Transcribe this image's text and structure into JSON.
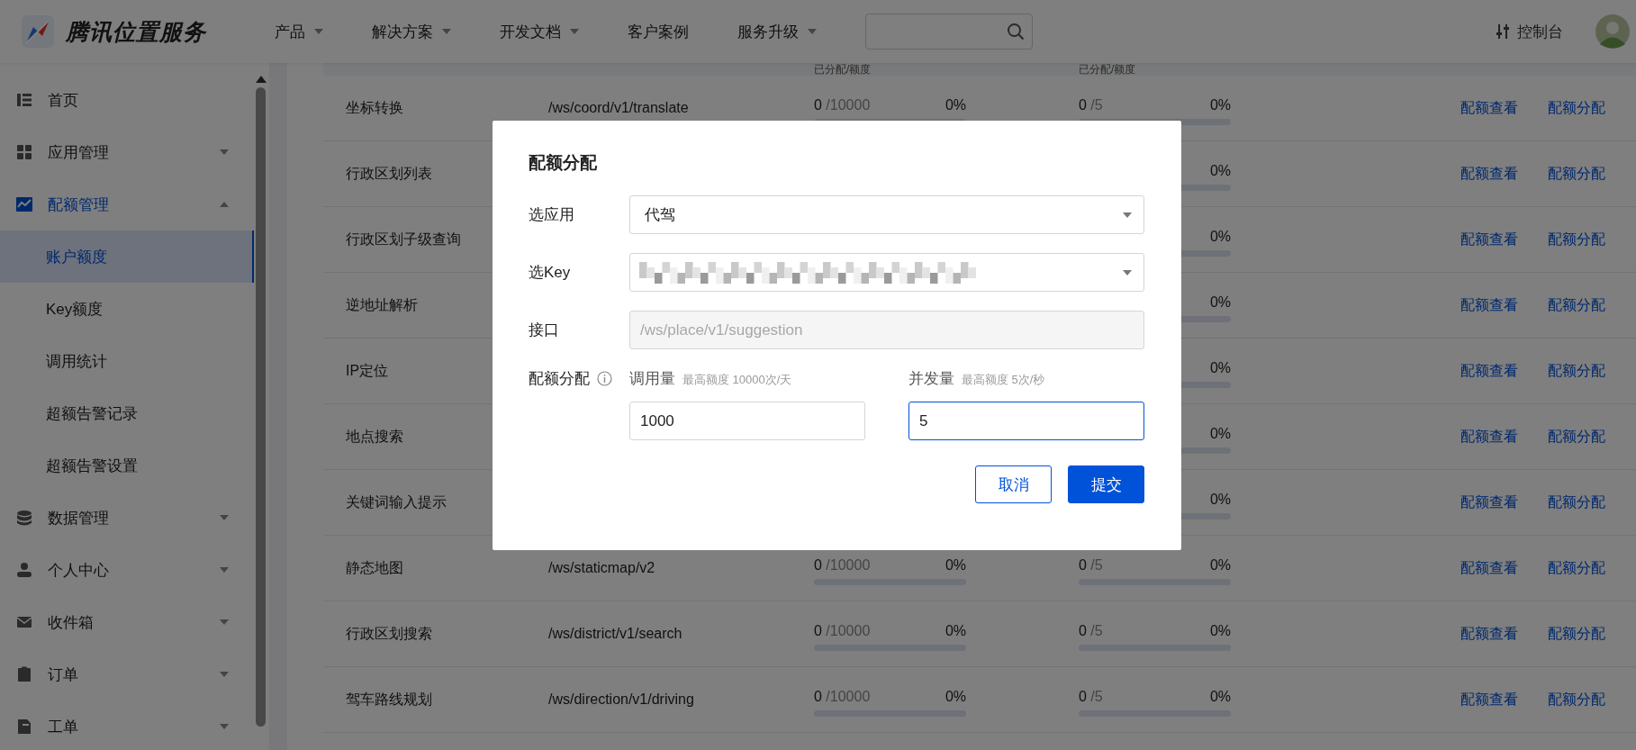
{
  "header": {
    "brand": "腾讯位置服务",
    "nav": [
      {
        "label": "产品",
        "dropdown": true
      },
      {
        "label": "解决方案",
        "dropdown": true
      },
      {
        "label": "开发文档",
        "dropdown": true
      },
      {
        "label": "客户案例",
        "dropdown": false
      },
      {
        "label": "服务升级",
        "dropdown": true
      }
    ],
    "console": "控制台"
  },
  "sidebar": {
    "items": [
      {
        "label": "首页",
        "active": false
      },
      {
        "label": "应用管理",
        "active": false,
        "expanded": false
      },
      {
        "label": "配额管理",
        "active": true,
        "expanded": true,
        "children": [
          {
            "label": "账户额度",
            "selected": true
          },
          {
            "label": "Key额度",
            "selected": false
          },
          {
            "label": "调用统计",
            "selected": false
          },
          {
            "label": "超额告警记录",
            "selected": false
          },
          {
            "label": "超额告警设置",
            "selected": false
          }
        ]
      },
      {
        "label": "数据管理",
        "active": false,
        "expanded": false
      },
      {
        "label": "个人中心",
        "active": false,
        "expanded": false
      },
      {
        "label": "收件箱",
        "active": false,
        "expanded": false
      },
      {
        "label": "订单",
        "active": false,
        "expanded": false
      },
      {
        "label": "工单",
        "active": false,
        "expanded": false
      }
    ]
  },
  "table": {
    "columns": [
      {
        "heading": "已分配/额度"
      },
      {
        "heading": "已分配/额度"
      }
    ],
    "rows": [
      {
        "name": "坐标转换",
        "path": "/ws/coord/v1/translate",
        "calls": {
          "used": "0",
          "limit": "/10000",
          "percent": "0%",
          "level": 0
        },
        "concurrency": {
          "used": "0",
          "limit": "/5",
          "percent": "0%",
          "level": 0
        },
        "actions": [
          "配额查看",
          "配额分配"
        ]
      },
      {
        "name": "行政区划列表",
        "concurrency": {
          "percent": "0%",
          "level": 0
        },
        "actions": [
          "配额查看",
          "配额分配"
        ]
      },
      {
        "name": "行政区划子级查询",
        "concurrency": {
          "percent": "0%",
          "level": 0
        },
        "actions": [
          "配额查看",
          "配额分配"
        ]
      },
      {
        "name": "逆地址解析",
        "concurrency": {
          "percent": "0%",
          "level": 0
        },
        "actions": [
          "配额查看",
          "配额分配"
        ]
      },
      {
        "name": "IP定位",
        "concurrency": {
          "percent": "0%",
          "level": 0
        },
        "actions": [
          "配额查看",
          "配额分配"
        ]
      },
      {
        "name": "地点搜索",
        "concurrency": {
          "percent": "0%",
          "level": 0
        },
        "actions": [
          "配额查看",
          "配额分配"
        ]
      },
      {
        "name": "关键词输入提示",
        "concurrency": {
          "percent": "0%",
          "level": 0
        },
        "actions": [
          "配额查看",
          "配额分配"
        ]
      },
      {
        "name": "静态地图",
        "path": "/ws/staticmap/v2",
        "calls": {
          "used": "0",
          "limit": "/10000",
          "percent": "0%",
          "level": 0
        },
        "concurrency": {
          "used": "0",
          "limit": "/5",
          "percent": "0%",
          "level": 0
        },
        "actions": [
          "配额查看",
          "配额分配"
        ]
      },
      {
        "name": "行政区划搜索",
        "path": "/ws/district/v1/search",
        "calls": {
          "used": "0",
          "limit": "/10000",
          "percent": "0%",
          "level": 0
        },
        "concurrency": {
          "used": "0",
          "limit": "/5",
          "percent": "0%",
          "level": 0
        },
        "actions": [
          "配额查看",
          "配额分配"
        ]
      },
      {
        "name": "驾车路线规划",
        "path": "/ws/direction/v1/driving",
        "calls": {
          "used": "0",
          "limit": "/10000",
          "percent": "0%",
          "level": 0
        },
        "concurrency": {
          "used": "0",
          "limit": "/5",
          "percent": "0%",
          "level": 0
        },
        "actions": [
          "配额查看",
          "配额分配"
        ]
      }
    ]
  },
  "dialog": {
    "title": "配额分配",
    "app_select": {
      "label": "选应用",
      "value": "代驾"
    },
    "key_select": {
      "label": "选Key"
    },
    "interface": {
      "label": "接口",
      "value": "/ws/place/v1/suggestion",
      "disabled": true
    },
    "quota": {
      "label": "配额分配",
      "fields": [
        {
          "label": "调用量",
          "hint": "最高额度 10000次/天",
          "value": "1000",
          "focused": false
        },
        {
          "label": "并发量",
          "hint": "最高额度 5次/秒",
          "value": "5",
          "focused": true
        }
      ]
    },
    "buttons": [
      {
        "label": "取消",
        "kind": "secondary"
      },
      {
        "label": "提交",
        "kind": "primary"
      }
    ]
  }
}
